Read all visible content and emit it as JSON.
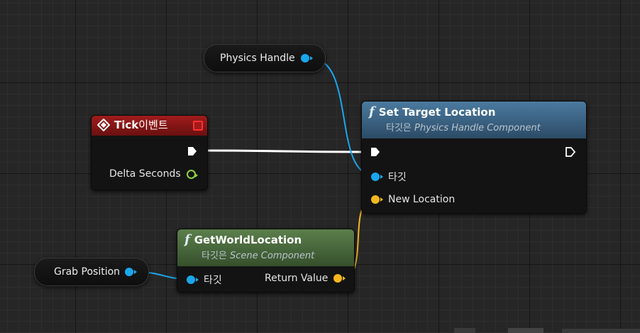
{
  "nodes": {
    "physics_handle": {
      "label": "Physics Handle"
    },
    "tick": {
      "title_bold": "Tick",
      "title_rest": " 이벤트",
      "output_label": "Delta Seconds"
    },
    "set_target_location": {
      "title": "Set Target Location",
      "sub_prefix": "타깃은 ",
      "sub_target": "Physics Handle Component",
      "input_target": "타깃",
      "input_location": "New Location"
    },
    "get_world_location": {
      "title": "GetWorldLocation",
      "sub_prefix": "타깃은 ",
      "sub_target": "Scene Component",
      "input_target": "타깃",
      "output_label": "Return Value"
    },
    "grab_position": {
      "label": "Grab Position"
    }
  },
  "colors": {
    "object_pin": "#1aa7ec",
    "vector_pin": "#f3b81e",
    "float_pin": "#8cd23c",
    "event_header": "#8a1616",
    "function_header": "#3c6383",
    "pure_function_header": "#4a6b3c",
    "exec_wire": "#ffffff"
  },
  "icons": {
    "event": "event-diamond-icon",
    "function": "function-f-icon",
    "exec": "exec-arrow-icon"
  }
}
